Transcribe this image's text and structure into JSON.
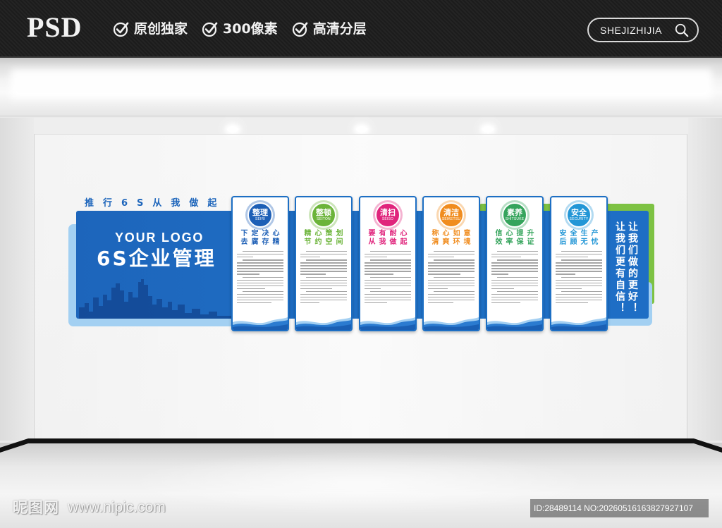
{
  "banner": {
    "logo": "PSD",
    "features": [
      {
        "label": "原创独家",
        "icon": "check-circle-icon"
      },
      {
        "label": "300像素",
        "icon": "check-circle-icon"
      },
      {
        "label": "高清分层",
        "icon": "check-circle-icon"
      }
    ],
    "search": {
      "label": "SHEJIZHIJIA",
      "icon": "search-icon"
    }
  },
  "display": {
    "slogan": "推行6S从我做起",
    "logo_text": "YOUR LOGO",
    "title": "6S企业管理",
    "cards": [
      {
        "title": "整理",
        "subtitle": "SEIRI",
        "motto_line1": "下定决心",
        "motto_line2": "去腐存精",
        "color": "#1d5fb6"
      },
      {
        "title": "整顿",
        "subtitle": "SEITON",
        "motto_line1": "精心策划",
        "motto_line2": "节约空间",
        "color": "#6cb43a"
      },
      {
        "title": "清扫",
        "subtitle": "SEISO",
        "motto_line1": "要有耐心",
        "motto_line2": "从我做起",
        "color": "#e0247c"
      },
      {
        "title": "清洁",
        "subtitle": "SEIKETSU",
        "motto_line1": "称心如意",
        "motto_line2": "清爽环境",
        "color": "#f08c1e"
      },
      {
        "title": "素养",
        "subtitle": "SHITSUKE",
        "motto_line1": "信心提升",
        "motto_line2": "效率保证",
        "color": "#35a45c"
      },
      {
        "title": "安全",
        "subtitle": "SECURITY",
        "motto_line1": "安全生产",
        "motto_line2": "后顾无忧",
        "color": "#2296d6"
      }
    ],
    "side_panel": [
      "让我们做的更好！",
      "让我们更有自信！"
    ]
  },
  "watermark": {
    "site_name": "昵图网",
    "url": "www.nipic.com",
    "id_text": "ID:28489114 NO:20260516163827927107"
  },
  "colors": {
    "brand_blue": "#1d65bb",
    "accent_green": "#7dc243",
    "light_blue": "#a3d0f2",
    "banner_bg": "#1c1c1c"
  }
}
